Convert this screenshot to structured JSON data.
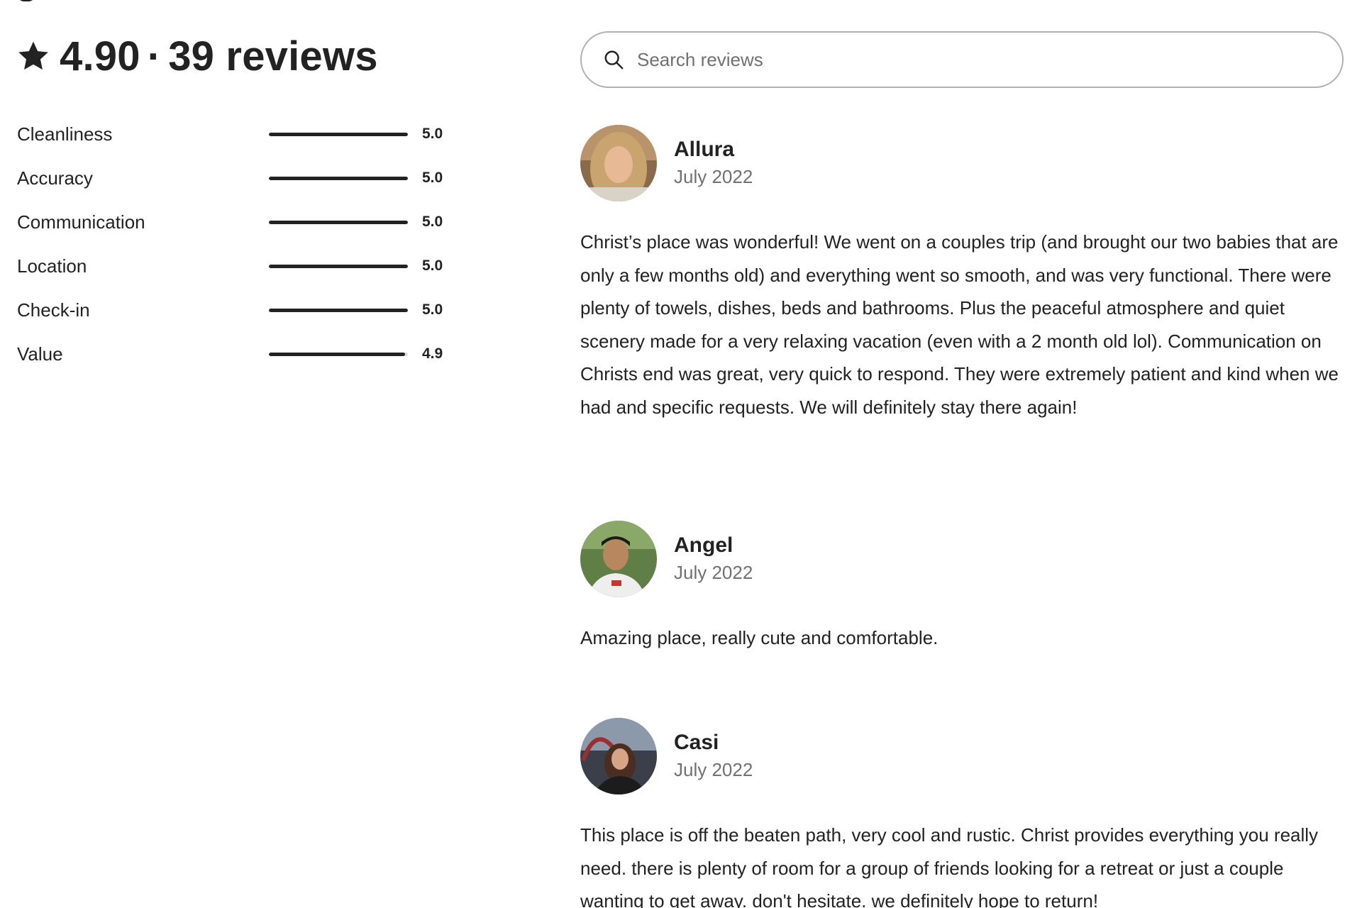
{
  "summary": {
    "rating": "4.90",
    "separator": "·",
    "review_count_label": "39 reviews"
  },
  "categories": [
    {
      "label": "Cleanliness",
      "value": "5.0",
      "fraction": 1.0
    },
    {
      "label": "Accuracy",
      "value": "5.0",
      "fraction": 1.0
    },
    {
      "label": "Communication",
      "value": "5.0",
      "fraction": 1.0
    },
    {
      "label": "Location",
      "value": "5.0",
      "fraction": 1.0
    },
    {
      "label": "Check-in",
      "value": "5.0",
      "fraction": 1.0
    },
    {
      "label": "Value",
      "value": "4.9",
      "fraction": 0.98
    }
  ],
  "search": {
    "placeholder": "Search reviews"
  },
  "reviews": [
    {
      "name": "Allura",
      "date": "July 2022",
      "text": "Christ’s place was wonderful! We went on a couples trip (and brought our two babies that are only a few months old) and everything went so smooth, and was very functional. There were plenty of towels, dishes, beds and bathrooms. Plus the peaceful atmosphere and quiet scenery made for a very relaxing vacation (even with a 2 month old lol). Communication on Christs end was great, very quick to respond. They were extremely patient and kind when we had and specific requests. We will definitely stay there again!"
    },
    {
      "name": "Angel",
      "date": "July 2022",
      "text": "Amazing place, really cute and comfortable."
    },
    {
      "name": "Casi",
      "date": "July 2022",
      "text": "This place is off the beaten path, very cool and rustic. Christ provides everything you really need. there is plenty of room for a group of friends looking for a retreat or just a couple wanting to get away. don't hesitate. we definitely hope to return!"
    }
  ],
  "colors": {
    "text": "#222222",
    "muted": "#717171",
    "border": "#b0b0b0",
    "bar_track": "#dddddd",
    "bar_fill": "#222222"
  },
  "icons": {
    "heading": "star-icon",
    "search": "search-icon"
  }
}
